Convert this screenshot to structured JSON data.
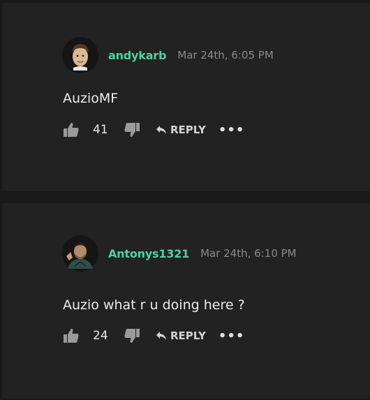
{
  "comments": [
    {
      "username": "andykarb",
      "timestamp": "Mar 24th, 6:05 PM",
      "text": "AuzioMF",
      "likes": "41",
      "reply_label": "REPLY",
      "more_label": "•••"
    },
    {
      "username": "Antonys1321",
      "timestamp": "Mar 24th, 6:10 PM",
      "text": "Auzio what r u doing here ?",
      "likes": "24",
      "reply_label": "REPLY",
      "more_label": "•••"
    }
  ],
  "colors": {
    "background": "#191919",
    "card": "#222222",
    "username": "#4fd1a1",
    "timestamp": "#8a8a8a",
    "text": "#ececec",
    "icon": "#9a9a9a"
  },
  "icons": [
    "thumbs-up-icon",
    "thumbs-down-icon",
    "reply-arrow-icon",
    "more-options-icon"
  ]
}
